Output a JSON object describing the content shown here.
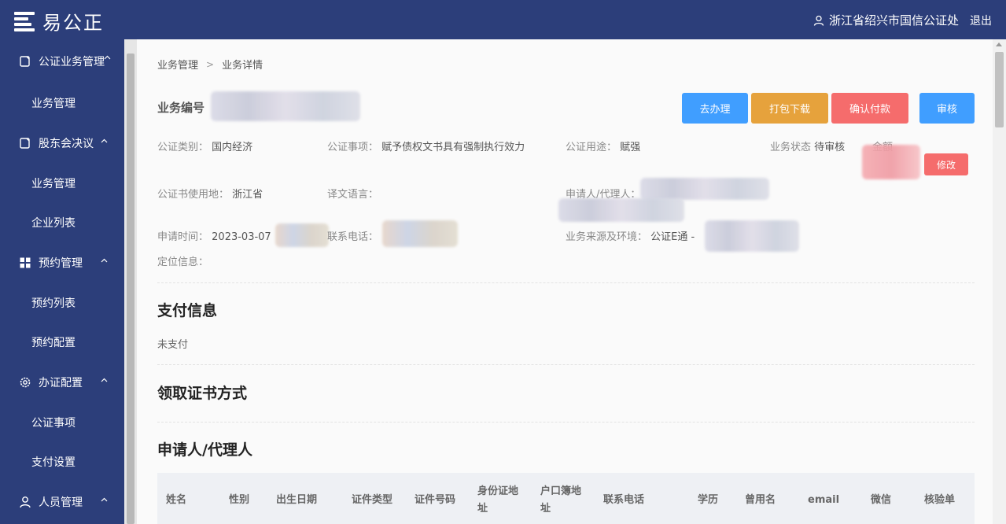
{
  "app": {
    "logo_text": "易公正",
    "user_name": "浙江省绍兴市国信公证处",
    "logout_label": "退出"
  },
  "sidebar": {
    "groups": [
      {
        "label": "公证业务管理",
        "items": [
          "业务管理"
        ]
      },
      {
        "label": "股东会决议",
        "items": [
          "业务管理",
          "企业列表"
        ]
      },
      {
        "label": "预约管理",
        "items": [
          "预约列表",
          "预约配置"
        ]
      },
      {
        "label": "办证配置",
        "items": [
          "公证事项",
          "支付设置"
        ]
      },
      {
        "label": "人员管理",
        "items": []
      }
    ]
  },
  "breadcrumb": {
    "root": "业务管理",
    "current": "业务详情"
  },
  "detail": {
    "biz_no_label": "业务编号",
    "buttons": {
      "handle": "去办理",
      "pack": "打包下载",
      "confirm_pay": "确认付款",
      "audit": "审核"
    },
    "fields": {
      "category_label": "公证类别：",
      "category_value": "国内经济",
      "matter_label": "公证事项：",
      "matter_value": "赋予债权文书具有强制执行效力",
      "use_label": "公证用途：",
      "use_value": "赋强",
      "status_label": "业务状态",
      "status_value": "待审核",
      "amount_label": "金额",
      "location_label": "公证书使用地：",
      "location_value": "浙江省",
      "translation_label": "译文语言：",
      "translation_value": "",
      "applicant_label": "申请人/代理人：",
      "apply_time_label": "申请时间：",
      "apply_time_value": "2023-03-07",
      "phone_label": "联系电话：",
      "source_label": "业务来源及环境：",
      "source_value": "公证E通 -",
      "geo_label": "定位信息："
    },
    "edit_label": "修改"
  },
  "payment": {
    "title": "支付信息",
    "status": "未支付"
  },
  "certificate": {
    "title": "领取证书方式"
  },
  "applicant_section": {
    "title": "申请人/代理人",
    "columns": [
      "姓名",
      "性别",
      "出生日期",
      "证件类型",
      "证件号码",
      "身份证地址",
      "户口簿地址",
      "联系电话",
      "学历",
      "曾用名",
      "email",
      "微信",
      "核验单"
    ]
  },
  "colors": {
    "nav_bg": "#2c3e7a",
    "primary": "#409eff",
    "warning": "#e6a23c",
    "danger": "#f56c6c"
  }
}
